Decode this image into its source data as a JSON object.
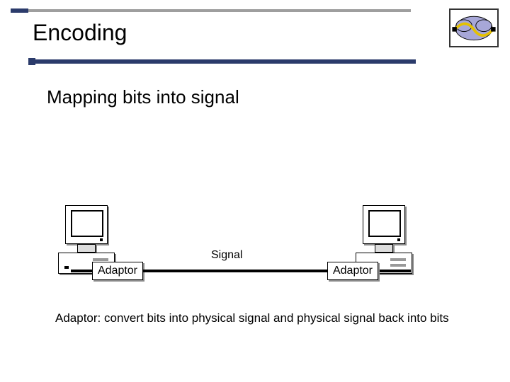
{
  "title": "Encoding",
  "subtitle": "Mapping bits into signal",
  "diagram": {
    "signal_label": "Signal",
    "adaptor_left_label": "Adaptor",
    "adaptor_right_label": "Adaptor"
  },
  "caption": "Adaptor: convert bits into physical signal and physical signal back into bits",
  "icons": {
    "corner": "cloud-wave-icon",
    "computer_left": "computer-icon",
    "computer_right": "computer-icon"
  },
  "colors": {
    "accent_dark": "#2b3b6b",
    "line_light": "#9e9e9e"
  }
}
